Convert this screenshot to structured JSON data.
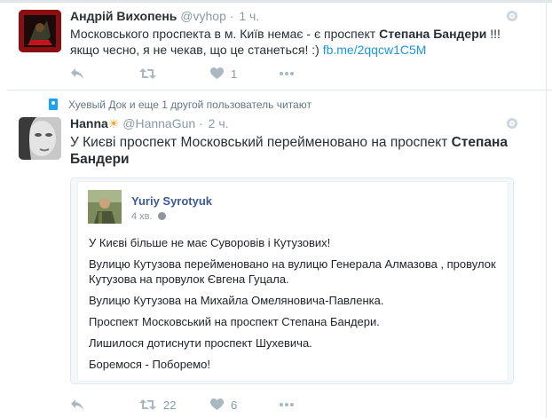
{
  "tweet1": {
    "fullname": "Андрій Вихопень",
    "handle": "@vyhop",
    "dot": "·",
    "time": "1 ч.",
    "text_part1": "Московського проспекта в м. Київ немає - є проспект ",
    "text_bold": "Степана Бандери",
    "text_part2": " !!!",
    "text_line2": "якщо чесно, я не чекав, що це станеться! :) ",
    "link": "fb.me/2qqcw1C5M",
    "like_count": "1"
  },
  "context": {
    "text": "Хуевый Док и еще 1 другой пользователь читают"
  },
  "tweet2": {
    "fullname": "Hanna",
    "emoji": "☀",
    "handle": "@HannaGun",
    "dot": "·",
    "time": "2 ч.",
    "text_part1": "У Києві проспект Московський перейменовано на проспект ",
    "text_bold1": "Степана",
    "text_bold2": "Бандери",
    "retweet_count": "22",
    "like_count": "6"
  },
  "fb_card": {
    "author": "Yuriy Syrotyuk",
    "time": "4 хв.",
    "lines": [
      "У Києві більше не має Суворовів і Кутузових!",
      "Вулицю Кутузова перейменовано на вулицю Генерала Алмазова , провулок Кутузова на провулок Євгена Гуцала.",
      "Вулицю Кутузова на Михайла Омеляновича-Павленка.",
      "Проспект Московський на проспект Степана Бандери.",
      "Лишилося дотиснути проспект Шухевича.",
      "Боремося - Поборемо!"
    ]
  },
  "colors": {
    "link": "#1b95e0",
    "muted": "#8899a6",
    "facebook_name": "#3b5998",
    "context_icon": "#1da1f2"
  },
  "icons": [
    "reply-icon",
    "retweet-icon",
    "like-icon",
    "more-icon",
    "caret-icon",
    "follow-context-icon",
    "globe-icon"
  ]
}
